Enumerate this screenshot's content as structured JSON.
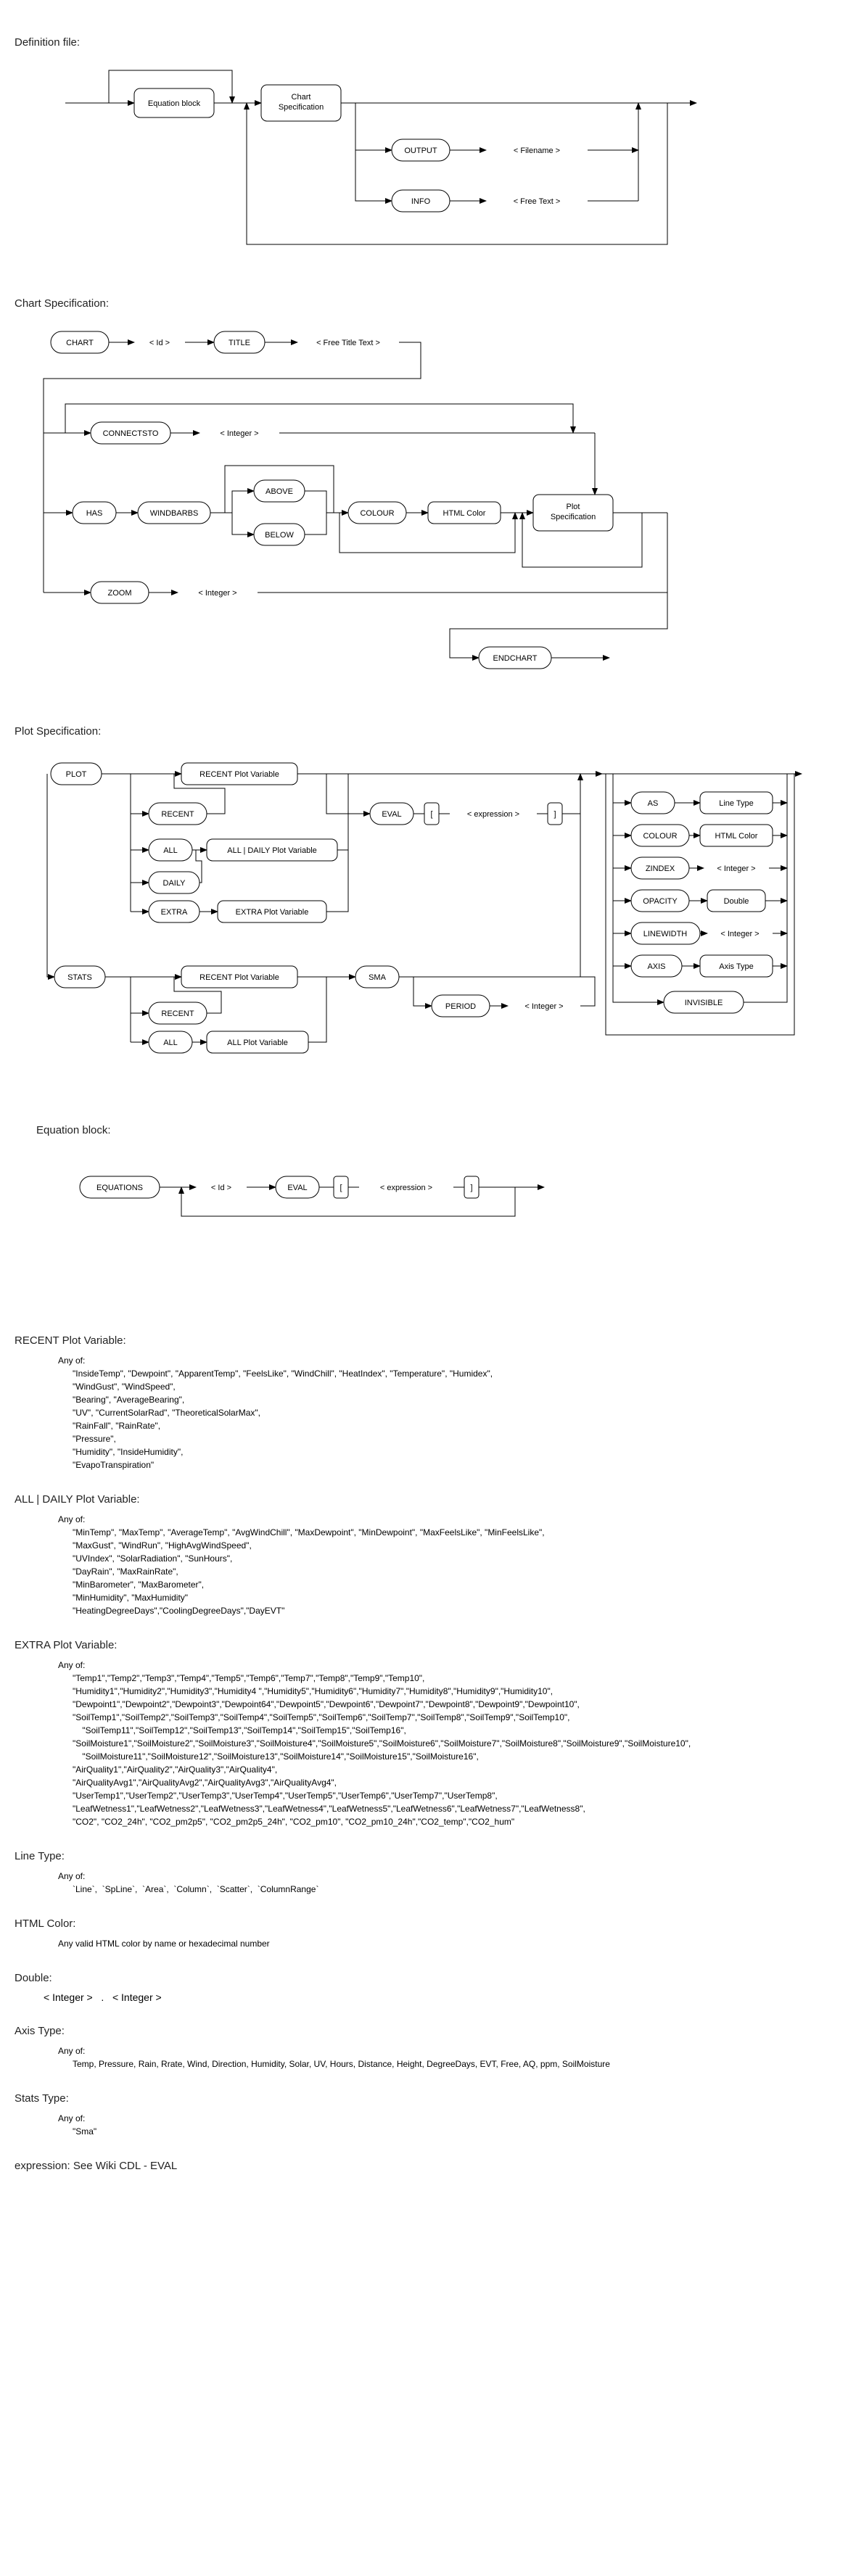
{
  "titles": {
    "defFile": "Definition file:",
    "chartSpec": "Chart Specification:",
    "plotSpec": "Plot Specification:",
    "eqBlock": "Equation block:",
    "recentVar": "RECENT Plot Variable:",
    "allDailyVar": "ALL | DAILY Plot Variable:",
    "extraVar": "EXTRA Plot Variable:",
    "lineType": "Line Type:",
    "htmlColor": "HTML Color:",
    "double": "Double:",
    "axisType": "Axis Type:",
    "statsType": "Stats Type:",
    "expression": "expression: See Wiki CDL - EVAL"
  },
  "nodes": {
    "equationBlock": "Equation block",
    "chartSpecification": "Chart\nSpecification",
    "output": "OUTPUT",
    "info": "INFO",
    "filename": "< Filename >",
    "freeText": "< Free Text >",
    "chart": "CHART",
    "id": "< Id >",
    "title": "TITLE",
    "freeTitle": "< Free Title Text >",
    "connectsTo": "CONNECTSTO",
    "integer": "< Integer >",
    "has": "HAS",
    "windbarbs": "WINDBARBS",
    "above": "ABOVE",
    "below": "BELOW",
    "colour": "COLOUR",
    "htmlColor": "HTML Color",
    "plotSpecification": "Plot\nSpecification",
    "zoom": "ZOOM",
    "endchart": "ENDCHART",
    "plot": "PLOT",
    "stats": "STATS",
    "recent": "RECENT",
    "all": "ALL",
    "daily": "DAILY",
    "extra": "EXTRA",
    "recentPlotVar": "RECENT Plot Variable",
    "allDailyPlotVar": "ALL | DAILY Plot Variable",
    "extraPlotVar": "EXTRA Plot Variable",
    "allPlotVar": "ALL Plot Variable",
    "eval": "EVAL",
    "expression": "< expression >",
    "lbracket": "[",
    "rbracket": "]",
    "sma": "SMA",
    "period": "PERIOD",
    "as": "AS",
    "lineTypeNode": "Line Type",
    "zindex": "ZINDEX",
    "opacity": "OPACITY",
    "doubleNode": "Double",
    "linewidth": "LINEWIDTH",
    "axis": "AXIS",
    "axisTypeNode": "Axis Type",
    "invisible": "INVISIBLE",
    "equations": "EQUATIONS"
  },
  "defs": {
    "anyOf": "Any of:",
    "recentList": "\"InsideTemp\", \"Dewpoint\", \"ApparentTemp\", \"FeelsLike\", \"WindChill\", \"HeatIndex\", \"Temperature\", \"Humidex\",\n\"WindGust\", \"WindSpeed\",\n\"Bearing\", \"AverageBearing\",\n\"UV\", \"CurrentSolarRad\", \"TheoreticalSolarMax\",\n\"RainFall\", \"RainRate\",\n\"Pressure\",\n\"Humidity\", \"InsideHumidity\",\n\"EvapoTranspiration\"",
    "allDailyList": "\"MinTemp\", \"MaxTemp\", \"AverageTemp\", \"AvgWindChill\", \"MaxDewpoint\", \"MinDewpoint\", \"MaxFeelsLike\", \"MinFeelsLike\",\n\"MaxGust\", \"WindRun\", \"HighAvgWindSpeed\",\n\"UVIndex\", \"SolarRadiation\", \"SunHours\",\n\"DayRain\", \"MaxRainRate\",\n\"MinBarometer\", \"MaxBarometer\",\n\"MinHumidity\", \"MaxHumidity\"\n\"HeatingDegreeDays\",\"CoolingDegreeDays\",\"DayEVT\"",
    "extraList": "\"Temp1\",\"Temp2\",\"Temp3\",\"Temp4\",\"Temp5\",\"Temp6\",\"Temp7\",\"Temp8\",\"Temp9\",\"Temp10\",\n\"Humidity1\",\"Humidity2\",\"Humidity3\",\"Humidity4 \",\"Humidity5\",\"Humidity6\",\"Humidity7\",\"Humidity8\",\"Humidity9\",\"Humidity10\",\n\"Dewpoint1\",\"Dewpoint2\",\"Dewpoint3\",\"Dewpoint64\",\"Dewpoint5\",\"Dewpoint6\",\"Dewpoint7\",\"Dewpoint8\",\"Dewpoint9\",\"Dewpoint10\",\n\"SoilTemp1\",\"SoilTemp2\",\"SoilTemp3\",\"SoilTemp4\",\"SoilTemp5\",\"SoilTemp6\",\"SoilTemp7\",\"SoilTemp8\",\"SoilTemp9\",\"SoilTemp10\",\n    \"SoilTemp11\",\"SoilTemp12\",\"SoilTemp13\",\"SoilTemp14\",\"SoilTemp15\",\"SoilTemp16\",\n\"SoilMoisture1\",\"SoilMoisture2\",\"SoilMoisture3\",\"SoilMoisture4\",\"SoilMoisture5\",\"SoilMoisture6\",\"SoilMoisture7\",\"SoilMoisture8\",\"SoilMoisture9\",\"SoilMoisture10\",\n    \"SoilMoisture11\",\"SoilMoisture12\",\"SoilMoisture13\",\"SoilMoisture14\",\"SoilMoisture15\",\"SoilMoisture16\",\n\"AirQuality1\",\"AirQuality2\",\"AirQuality3\",\"AirQuality4\",\n\"AirQualityAvg1\",\"AirQualityAvg2\",\"AirQualityAvg3\",\"AirQualityAvg4\",\n\"UserTemp1\",\"UserTemp2\",\"UserTemp3\",\"UserTemp4\",\"UserTemp5\",\"UserTemp6\",\"UserTemp7\",\"UserTemp8\",\n\"LeafWetness1\",\"LeafWetness2\",\"LeafWetness3\",\"LeafWetness4\",\"LeafWetness5\",\"LeafWetness6\",\"LeafWetness7\",\"LeafWetness8\",\n\"CO2\", \"CO2_24h\", \"CO2_pm2p5\", \"CO2_pm2p5_24h\", \"CO2_pm10\", \"CO2_pm10_24h\",\"CO2_temp\",\"CO2_hum\"",
    "lineTypeList": "`Line`,  `SpLine`,  `Area`,  `Column`,  `Scatter`,  `ColumnRange`",
    "htmlColorDesc": "Any valid HTML color by name or hexadecimal number",
    "axisTypeList": "Temp, Pressure, Rain, Rrate, Wind, Direction, Humidity, Solar, UV, Hours, Distance, Height, DegreeDays, EVT, Free, AQ, ppm, SoilMoisture",
    "statsList": "\"Sma\"",
    "doublePart1": "< Integer >",
    "doubleDot": ".",
    "doublePart2": "< Integer >"
  }
}
